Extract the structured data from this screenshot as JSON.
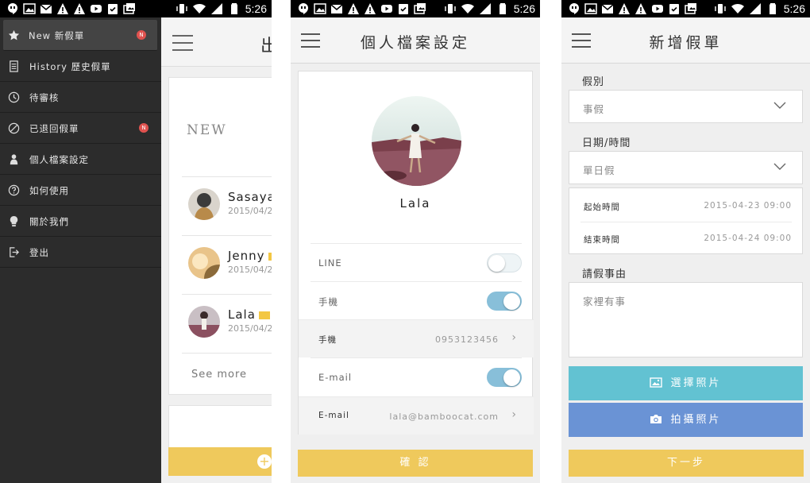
{
  "status_bar": {
    "time": "5:26"
  },
  "drawer": {
    "items": [
      {
        "label": "New  新假單",
        "icon": "star-icon",
        "badge": "N"
      },
      {
        "label": "History  歷史假單",
        "icon": "document-icon",
        "badge": ""
      },
      {
        "label": "待審核",
        "icon": "clock-icon",
        "badge": ""
      },
      {
        "label": "已退回假單",
        "icon": "prohibited-icon",
        "badge": "N"
      },
      {
        "label": "個人檔案設定",
        "icon": "person-icon",
        "badge": ""
      },
      {
        "label": "如何使用",
        "icon": "question-icon",
        "badge": ""
      },
      {
        "label": "關於我們",
        "icon": "bulb-icon",
        "badge": ""
      },
      {
        "label": "登出",
        "icon": "logout-icon",
        "badge": ""
      }
    ],
    "behind": {
      "title_partial": "出",
      "section": "NEW",
      "people": [
        {
          "name": "Sasaya",
          "date": "2015/04/2"
        },
        {
          "name": "Jenny",
          "date": "2015/04/2"
        },
        {
          "name": "Lala",
          "date": "2015/04/2"
        }
      ],
      "see_more": "See more"
    }
  },
  "profile": {
    "title": "個人檔案設定",
    "name": "Lala",
    "line_label": "LINE",
    "line_on": false,
    "phone_toggle_label": "手機",
    "phone_on": true,
    "phone_label": "手機",
    "phone_value": "0953123456",
    "email_toggle_label": "E-mail",
    "email_on": true,
    "email_label": "E-mail",
    "email_value": "lala@bamboocat.com",
    "confirm": "確 認"
  },
  "new_leave": {
    "title": "新增假單",
    "type_label": "假別",
    "type_value": "事假",
    "datetime_label": "日期/時間",
    "duration_value": "單日假",
    "start_label": "起始時間",
    "start_value": "2015-04-23  09:00",
    "end_label": "結束時間",
    "end_value": "2015-04-24  09:00",
    "reason_label": "請假事由",
    "reason_value": "家裡有事",
    "choose_photo": "選擇照片",
    "take_photo": "拍攝照片",
    "next": "下一步"
  },
  "colors": {
    "accent_yellow": "#efc95c",
    "teal": "#62c2d2",
    "blue": "#6a93d5",
    "toggle_on": "#88bfd9",
    "badge_red": "#e0524f",
    "drawer_bg": "#2c2c2c"
  }
}
